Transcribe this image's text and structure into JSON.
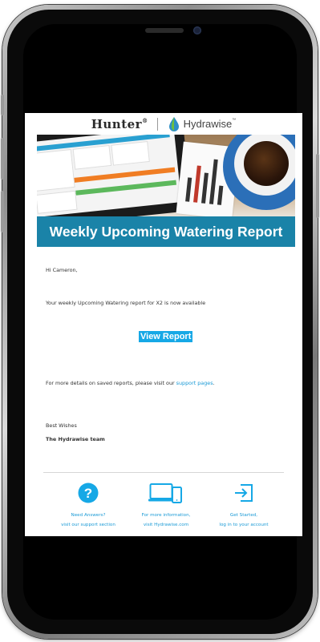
{
  "brand": {
    "hunter_logo": "Hunter",
    "hydrawise_logo": "Hydrawise"
  },
  "banner": {
    "title": "Weekly Upcoming Watering Report"
  },
  "email": {
    "greeting": "Hi Cameron,",
    "intro": "Your weekly Upcoming Watering report for X2 is now available",
    "view_report_label": "View Report",
    "details_prefix": "For more details on saved reports, please visit our ",
    "details_link": "support pages",
    "details_suffix": ".",
    "signoff": "Best Wishes",
    "team": "The Hydrawise team"
  },
  "footer": {
    "items": [
      {
        "line1": "Need Answers?",
        "line2": "visit our support section",
        "icon": "question-icon"
      },
      {
        "line1": "For more information,",
        "line2": "visit Hydrawise.com",
        "icon": "devices-icon"
      },
      {
        "line1": "Get Started,",
        "line2": "log in to your account",
        "icon": "login-icon"
      }
    ]
  },
  "colors": {
    "banner": "#1a83a8",
    "button": "#16a8e6",
    "link": "#1a9ad6"
  }
}
